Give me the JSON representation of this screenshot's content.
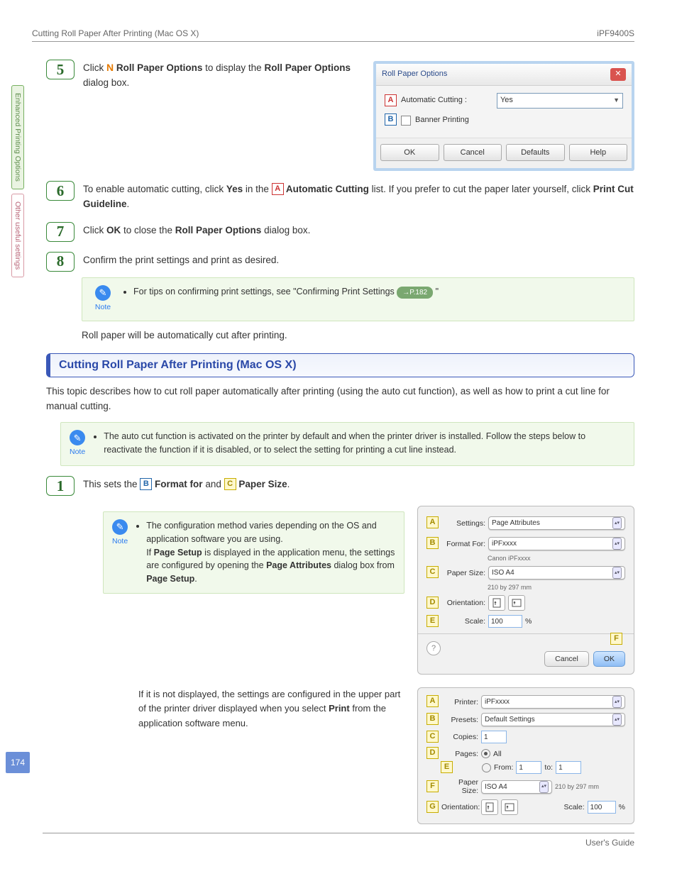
{
  "header": {
    "left": "Cutting Roll Paper After Printing (Mac OS X)",
    "right": "iPF9400S"
  },
  "sideTabs": {
    "green": "Enhanced Printing Options",
    "pink": "Other useful settings"
  },
  "pageNumber": "174",
  "footer": "User's Guide",
  "steps": {
    "s5": {
      "num": "5",
      "t1": "Click ",
      "t2": "N",
      "t3": " Roll Paper Options",
      "t4": " to display the ",
      "t5": "Roll Paper Options",
      "t6": " dialog box."
    },
    "s6": {
      "num": "6",
      "t1": "To enable automatic cutting, click ",
      "t2": "Yes",
      "t3": " in the ",
      "t4": "A",
      "t5": " Automatic Cutting",
      "t6": " list. If you prefer to cut the paper later yourself, click ",
      "t7": "Print Cut Guideline",
      "t8": "."
    },
    "s7": {
      "num": "7",
      "t1": "Click ",
      "t2": "OK",
      "t3": " to close the ",
      "t4": "Roll Paper Options",
      "t5": " dialog box."
    },
    "s8": {
      "num": "8",
      "t1": "Confirm the print settings and print as desired."
    },
    "note1": {
      "bullet": "For tips on confirming print settings, see \"Confirming Print Settings ",
      "link": "→P.182",
      "tail": " \"",
      "label": "Note"
    },
    "afterNote": "Roll paper will be automatically cut after printing.",
    "s1": {
      "num": "1",
      "t1": "This sets the ",
      "t2": "B",
      "t3": " Format for",
      "t4": " and ",
      "t5": "C",
      "t6": " Paper Size",
      "t7": "."
    }
  },
  "section": {
    "title": "Cutting Roll Paper After Printing (Mac OS X)",
    "intro": "This topic describes how to cut roll paper automatically after printing (using the auto cut function), as well as how to print a cut line for manual cutting.",
    "note": {
      "text": "The auto cut function is activated on the printer by default and when the printer driver is installed. Follow the steps below to reactivate the function if it is disabled, or to select the setting for printing a cut line instead.",
      "label": "Note"
    }
  },
  "dialog": {
    "title": "Roll Paper Options",
    "rowA": "Automatic Cutting :",
    "rowA_val": "Yes",
    "rowB": "Banner Printing",
    "buttons": {
      "ok": "OK",
      "cancel": "Cancel",
      "defaults": "Defaults",
      "help": "Help"
    }
  },
  "mac1": {
    "settings_l": "Settings:",
    "settings_v": "Page Attributes",
    "format_l": "Format For:",
    "format_v": "iPFxxxx",
    "format_sub": "Canon iPFxxxx",
    "paper_l": "Paper Size:",
    "paper_v": "ISO A4",
    "paper_sub": "210 by 297 mm",
    "orient_l": "Orientation:",
    "scale_l": "Scale:",
    "scale_v": "100",
    "scale_pct": "%",
    "cancel": "Cancel",
    "ok": "OK",
    "letters": {
      "a": "A",
      "b": "B",
      "c": "C",
      "d": "D",
      "e": "E",
      "f": "F"
    }
  },
  "noteConfig": {
    "label": "Note",
    "b1a": "The configuration method varies depending on the OS and application software you are using.",
    "b1b_1": "If ",
    "b1b_2": "Page Setup",
    "b1b_3": " is displayed in the application menu, the settings are configured by opening the ",
    "b1b_4": "Page Attributes",
    "b1b_5": " dialog box from ",
    "b1b_6": "Page Setup",
    "b1b_7": "."
  },
  "para2": {
    "t1": "If it is not displayed, the settings are configured in the upper part of the printer driver displayed when you select ",
    "t2": "Print",
    "t3": " from the application software menu."
  },
  "mac2": {
    "printer_l": "Printer:",
    "printer_v": "iPFxxxx",
    "presets_l": "Presets:",
    "presets_v": "Default Settings",
    "copies_l": "Copies:",
    "copies_v": "1",
    "pages_l": "Pages:",
    "all": "All",
    "from": "From:",
    "from_v": "1",
    "to": "to:",
    "to_v": "1",
    "paper_l": "Paper Size:",
    "paper_v": "ISO A4",
    "paper_sub": "210 by 297 mm",
    "orient_l": "Orientation:",
    "scale_l": "Scale:",
    "scale_v": "100",
    "scale_pct": "%",
    "letters": {
      "a": "A",
      "b": "B",
      "c": "C",
      "d": "D",
      "e": "E",
      "f": "F",
      "g": "G"
    }
  }
}
